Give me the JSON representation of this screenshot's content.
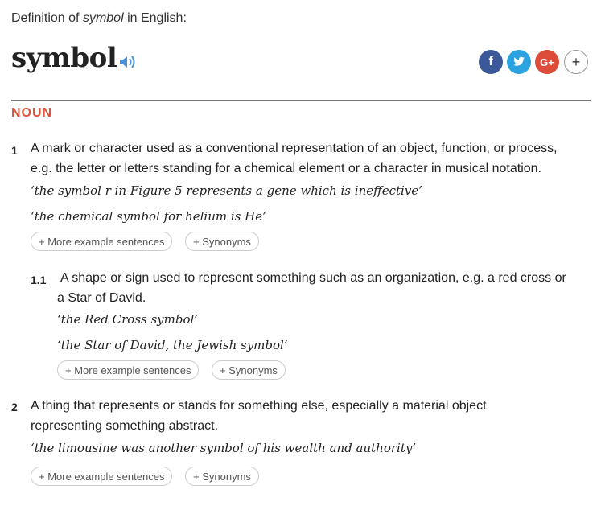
{
  "header": {
    "prefix": "Definition of ",
    "word_italic": "symbol",
    "suffix": " in English:"
  },
  "headword": "symbol",
  "icons": {
    "audio": "speaker-icon",
    "share": [
      "facebook-icon",
      "twitter-icon",
      "google-plus-icon",
      "more-icon"
    ]
  },
  "share_labels": {
    "facebook": "f",
    "google_plus": "G+",
    "more": "+"
  },
  "part_of_speech": "NOUN",
  "senses": [
    {
      "number": "1",
      "definition_line1": "A mark or character used as a conventional representation of an object, function, or process,",
      "definition_line2": "e.g. the letter or letters standing for a chemical element or a character in musical notation.",
      "examples": [
        "‘the symbol r in Figure 5 represents a gene which is ineffective’",
        "‘the chemical symbol for helium is He’"
      ],
      "more_examples_label": "+ More example sentences",
      "synonyms_label": "+ Synonyms"
    },
    {
      "number": "1.1",
      "definition_line1": "A shape or sign used to represent something such as an organization, e.g. a red cross or",
      "definition_line2": "a Star of David.",
      "examples": [
        "‘the Red Cross symbol’",
        "‘the Star of David, the Jewish symbol’"
      ],
      "more_examples_label": "+ More example sentences",
      "synonyms_label": "+ Synonyms"
    },
    {
      "number": "2",
      "definition_line1": "A thing that represents or stands for something else, especially a material object",
      "definition_line2": "representing something abstract.",
      "examples": [
        "‘the limousine was another symbol of his wealth and authority’"
      ],
      "more_examples_label": "+ More example sentences",
      "synonyms_label": "+ Synonyms"
    }
  ],
  "colors": {
    "pos": "#e0523a",
    "facebook": "#3b5998",
    "twitter": "#2aa3e0",
    "google_plus": "#dd4b39"
  }
}
